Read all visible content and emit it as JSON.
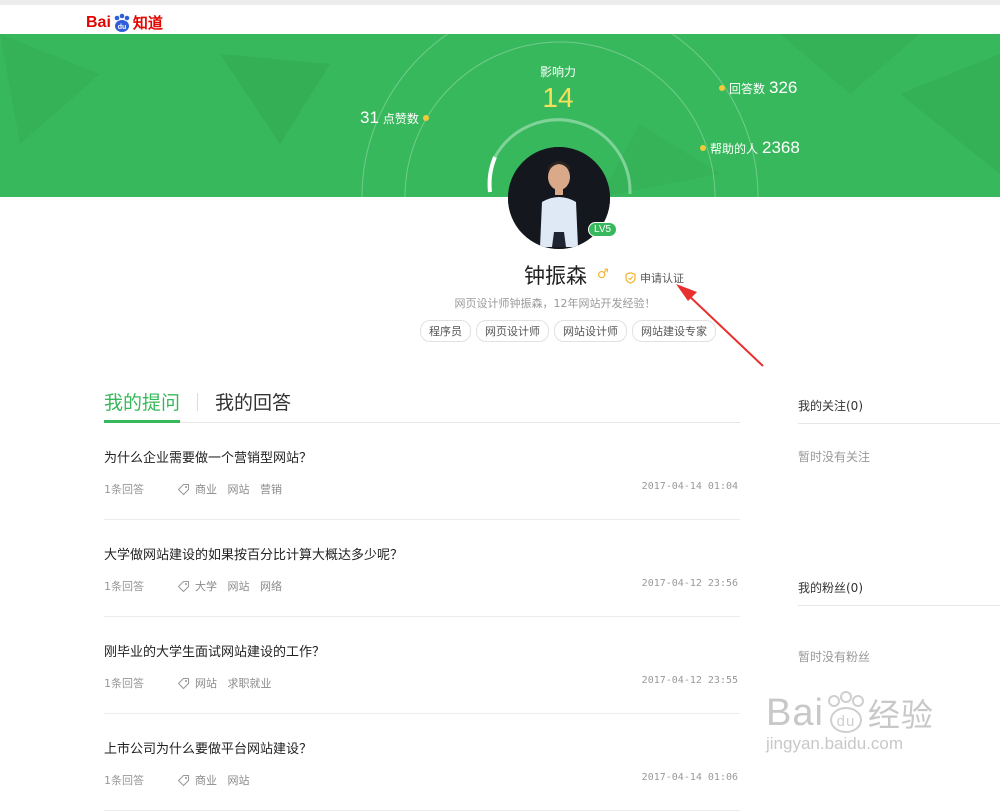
{
  "header": {
    "logo_prefix": "Bai",
    "logo_paw_text": "du",
    "logo_suffix": "知道"
  },
  "stats": {
    "influence_label": "影响力",
    "influence_value": "14",
    "likes_value": "31",
    "likes_label": "点赞数",
    "answers_label": "回答数",
    "answers_value": "326",
    "helped_label": "帮助的人",
    "helped_value": "2368"
  },
  "profile": {
    "level": "LV5",
    "name": "钟振森",
    "gender_symbol": "♂",
    "certify_label": "申请认证",
    "bio": "网页设计师钟振森，12年网站开发经验！",
    "tags": [
      "程序员",
      "网页设计师",
      "网站设计师",
      "网站建设专家"
    ]
  },
  "tabs": {
    "my_questions": "我的提问",
    "my_answers": "我的回答"
  },
  "questions": [
    {
      "title": "为什么企业需要做一个营销型网站？",
      "answers": "1条回答",
      "tags": [
        "商业",
        "网站",
        "营销"
      ],
      "time": "2017-04-14 01:04"
    },
    {
      "title": "大学做网站建设的如果按百分比计算大概达多少呢？",
      "answers": "1条回答",
      "tags": [
        "大学",
        "网站",
        "网络"
      ],
      "time": "2017-04-12 23:56"
    },
    {
      "title": "刚毕业的大学生面试网站建设的工作？",
      "answers": "1条回答",
      "tags": [
        "网站",
        "求职就业"
      ],
      "time": "2017-04-12 23:55"
    },
    {
      "title": "上市公司为什么要做平台网站建设？",
      "answers": "1条回答",
      "tags": [
        "商业",
        "网站"
      ],
      "time": "2017-04-14 01:06"
    }
  ],
  "sidebar": {
    "following_title": "我的关注(0)",
    "following_empty": "暂时没有关注",
    "fans_title": "我的粉丝(0)",
    "fans_empty": "暂时没有粉丝"
  },
  "watermark": {
    "brand_a": "Bai",
    "brand_b": "du",
    "brand_cn": "经验",
    "url": "jingyan.baidu.com"
  },
  "colors": {
    "brand_green": "#38b85c",
    "accent_yellow": "#f5c93a",
    "baidu_red": "#e10601",
    "annotation_red": "#e8302f"
  }
}
